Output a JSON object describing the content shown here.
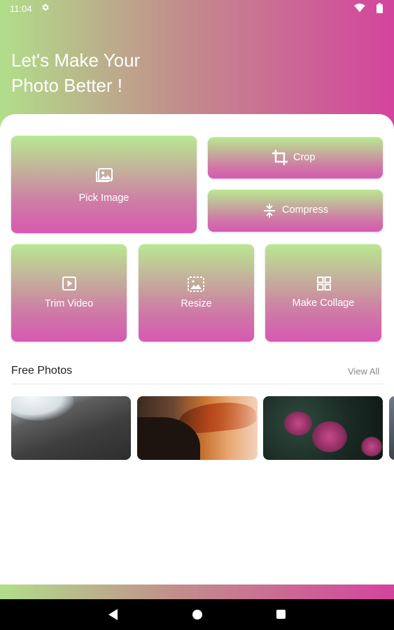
{
  "status_bar": {
    "time": "11:04"
  },
  "header": {
    "headline": "Let's Make Your\nPhoto Better !"
  },
  "tools": {
    "pick_image": "Pick Image",
    "crop": "Crop",
    "compress": "Compress",
    "trim_video": "Trim Video",
    "resize": "Resize",
    "make_collage": "Make Collage"
  },
  "free_photos": {
    "title": "Free Photos",
    "view_all": "View All"
  },
  "colors": {
    "gradient_start": "#b1de8a",
    "gradient_end": "#d4449d",
    "tile_top": "#b8e890",
    "tile_bottom": "#d659b2"
  },
  "icons": [
    "gear-icon",
    "wifi-icon",
    "battery-icon",
    "image-icon",
    "crop-icon",
    "compress-icon",
    "play-icon",
    "resize-icon",
    "collage-icon"
  ]
}
